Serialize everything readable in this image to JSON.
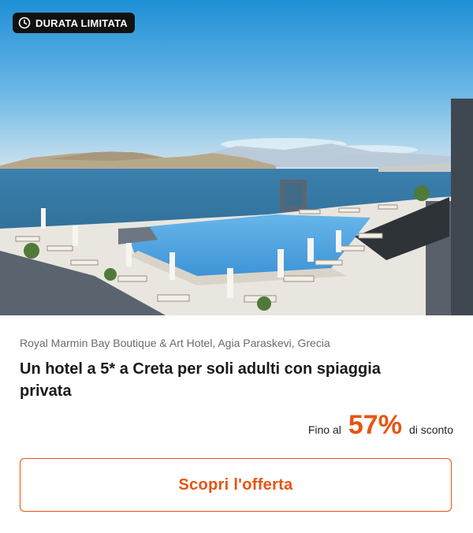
{
  "badge": {
    "label": "DURATA LIMITATA",
    "icon": "clock-icon"
  },
  "hero": {
    "icon": "hotel-pool-photo"
  },
  "offer": {
    "location": "Royal Marmin Bay Boutique & Art Hotel, Agia Paraskevi, Grecia",
    "title": "Un hotel a 5* a Creta per soli adulti con spiaggia privata",
    "discount_prefix": "Fino al",
    "discount_value": "57%",
    "discount_suffix": "di sconto"
  },
  "cta": {
    "label": "Scopri l'offerta"
  },
  "colors": {
    "accent": "#e8540f",
    "badge_bg": "#111111"
  }
}
